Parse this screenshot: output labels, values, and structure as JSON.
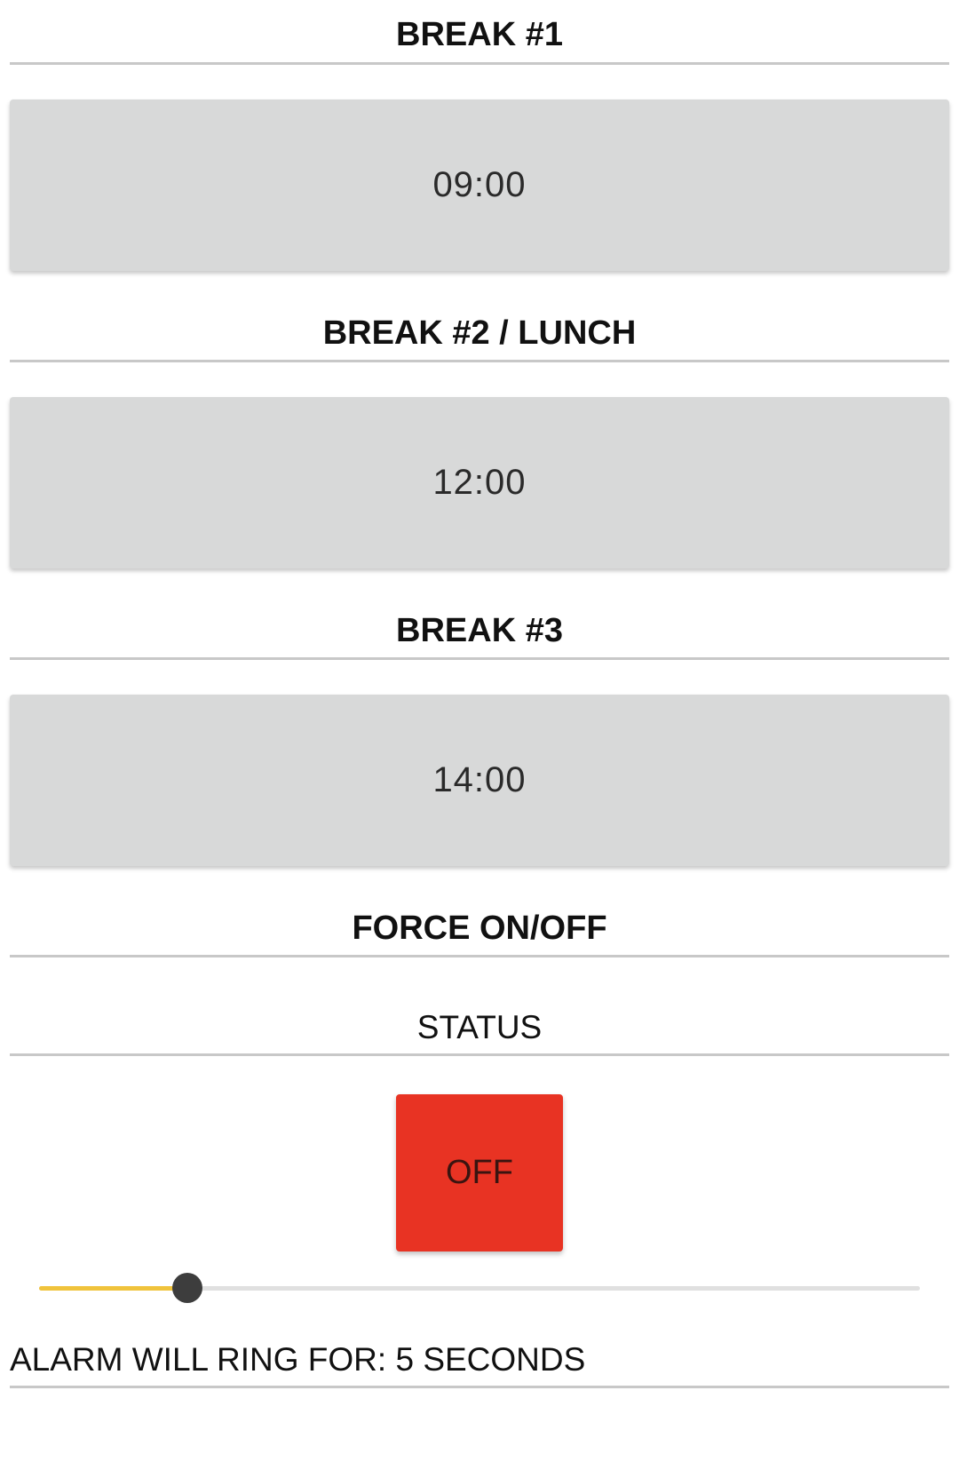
{
  "breaks": [
    {
      "title": "BREAK #1",
      "time": "09:00"
    },
    {
      "title": "BREAK #2 / LUNCH",
      "time": "12:00"
    },
    {
      "title": "BREAK #3",
      "time": "14:00"
    }
  ],
  "force": {
    "title": "FORCE ON/OFF",
    "status_label": "STATUS",
    "button_label": "OFF",
    "button_color": "#e83323"
  },
  "alarm": {
    "slider_fraction": 0.168,
    "slider_fill_color": "#f0c33c",
    "text": "ALARM WILL RING FOR: 5 SECONDS"
  }
}
